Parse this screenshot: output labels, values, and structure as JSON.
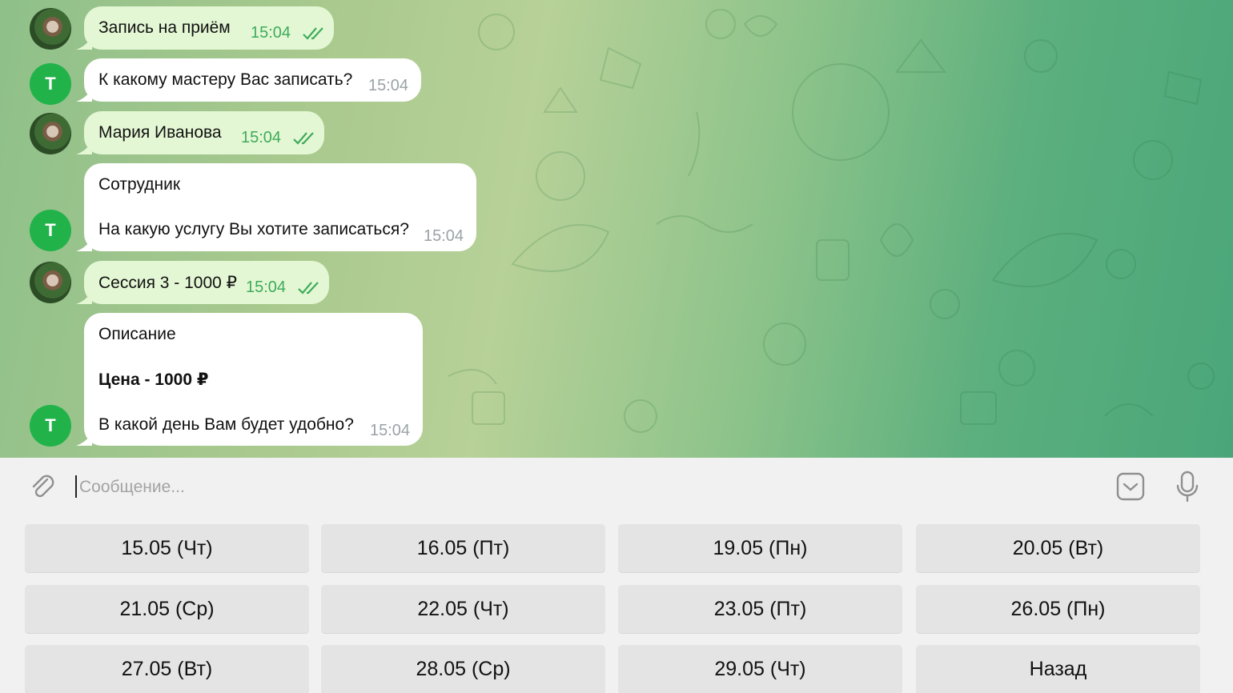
{
  "messages": [
    {
      "side": "out",
      "sender_avatar": "user",
      "text": "Запись на приём",
      "time": "15:04",
      "read": true
    },
    {
      "side": "in",
      "sender_avatar": "bot",
      "avatar_letter": "Т",
      "text": "К какому мастеру Вас записать?",
      "time": "15:04"
    },
    {
      "side": "out",
      "sender_avatar": "user",
      "text": "Мария Иванова",
      "time": "15:04",
      "read": true
    },
    {
      "side": "in",
      "sender_avatar": "bot",
      "avatar_letter": "Т",
      "line1": "Сотрудник",
      "line2": "На какую услугу Вы хотите записаться?",
      "time": "15:04"
    },
    {
      "side": "out",
      "sender_avatar": "user",
      "text": "Сессия 3 - 1000 ₽",
      "time": "15:04",
      "read": true
    },
    {
      "side": "in",
      "sender_avatar": "bot",
      "avatar_letter": "Т",
      "line1": "Описание",
      "line2": "Цена - 1000 ₽",
      "line3": "В какой день Вам будет удобно?",
      "time": "15:04"
    }
  ],
  "composer": {
    "placeholder": "Сообщение...",
    "attach_icon": "paperclip-icon",
    "keyboard_icon": "keyboard-toggle-icon",
    "mic_icon": "microphone-icon"
  },
  "keyboard": {
    "buttons": [
      "15.05 (Чт)",
      "16.05 (Пт)",
      "19.05 (Пн)",
      "20.05 (Вт)",
      "21.05 (Ср)",
      "22.05 (Чт)",
      "23.05 (Пт)",
      "26.05 (Пн)",
      "27.05 (Вт)",
      "28.05 (Ср)",
      "29.05 (Чт)",
      "Назад"
    ]
  },
  "colors": {
    "outgoing_bubble": "#e4f7d4",
    "incoming_bubble": "#ffffff",
    "accent_green": "#3dab5b",
    "bot_avatar": "#21b34a"
  }
}
